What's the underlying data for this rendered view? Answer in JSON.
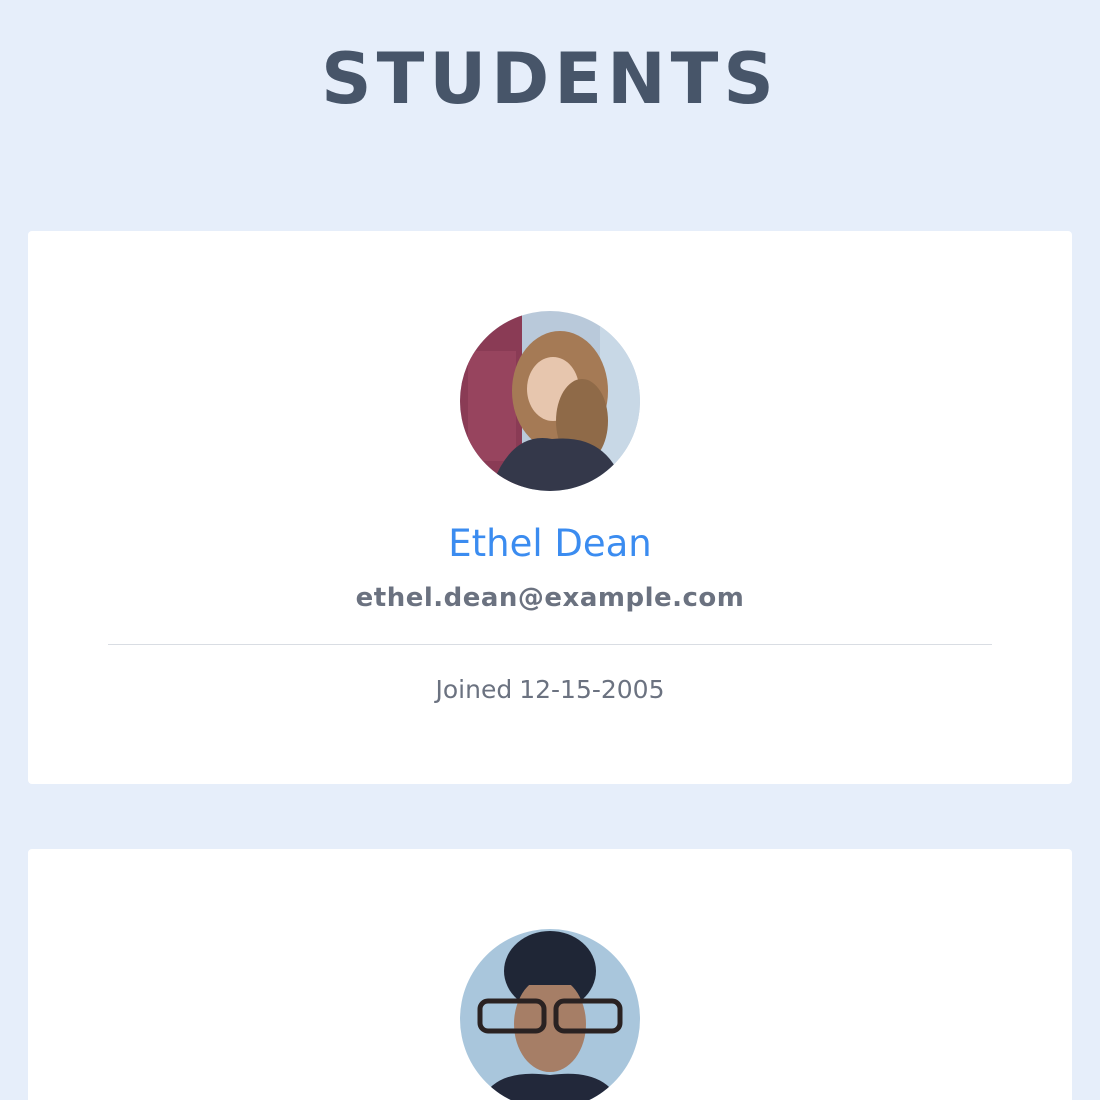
{
  "header": {
    "title": "STUDENTS"
  },
  "students": [
    {
      "name": "Ethel Dean",
      "email": "ethel.dean@example.com",
      "joined_prefix": "Joined",
      "joined_date": "12-15-2005",
      "avatar": "profile-photo"
    },
    {
      "avatar": "profile-photo"
    }
  ],
  "colors": {
    "background": "#e6eefa",
    "card": "#ffffff",
    "title": "#475569",
    "name": "#3b8cf0",
    "muted": "#6b7280",
    "divider": "#d9dde3"
  }
}
